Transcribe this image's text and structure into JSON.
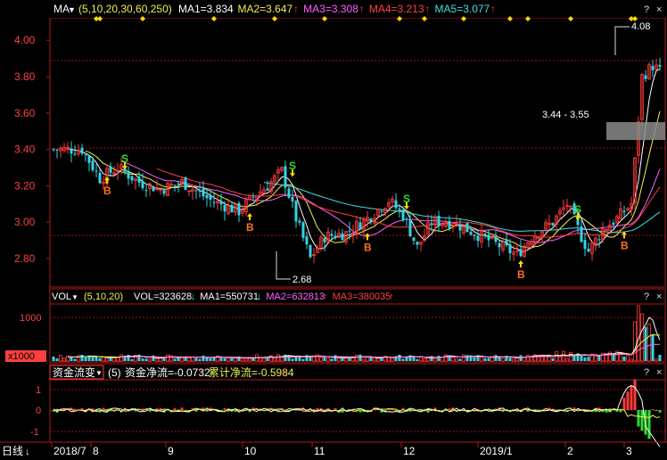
{
  "colors": {
    "bg": "#000000",
    "grid": "#8a1010",
    "frame": "#b01818",
    "up": "#ff3a3a",
    "down": "#32d6e6",
    "ma1": "#ffffff",
    "ma2": "#f0f050",
    "ma3": "#ff60ff",
    "ma4": "#ff4040",
    "ma5": "#40e0e0",
    "axis_text": "#ff4040",
    "header_text": "#ffffff",
    "signal_s": "#30e030",
    "signal_b": "#ff7020",
    "arrow": "#ffd800",
    "diamond": "#ffd800"
  },
  "main_panel": {
    "indicator": "MA",
    "params": "(5,10,20,30,60,250)",
    "legend": [
      {
        "text": "MA1=3.834",
        "color": "#ffffff"
      },
      {
        "text": "MA2=3.647",
        "color": "#f0f050",
        "arrow": "↑"
      },
      {
        "text": "MA3=3.308",
        "color": "#ff60ff",
        "arrow": "↑"
      },
      {
        "text": "MA4=3.213",
        "color": "#ff4040",
        "arrow": "↑"
      },
      {
        "text": "MA5=3.077",
        "color": "#40e0e0",
        "arrow": "↑"
      }
    ],
    "y_ticks": [
      "4.00",
      "3.80",
      "3.60",
      "3.40",
      "3.20",
      "3.00",
      "2.80"
    ],
    "annotations": {
      "high": "4.08",
      "low": "2.68",
      "range": "3.44 - 3.55"
    }
  },
  "vol_panel": {
    "indicator": "VOL",
    "params": "(5,10,20)",
    "legend": [
      {
        "text": "VOL=323628",
        "color": "#ffffff",
        "arrow": "↓",
        "arrow_color": "#40e0e0"
      },
      {
        "text": "MA1=550731",
        "color": "#ffffff",
        "arrow": "↓",
        "arrow_color": "#40e0e0"
      },
      {
        "text": "MA2=632813",
        "color": "#ff60ff",
        "arrow": "↑",
        "arrow_color": "#ff4040"
      },
      {
        "text": "MA3=380035",
        "color": "#ff4040",
        "arrow": "↑",
        "arrow_color": "#ff4040"
      }
    ],
    "y_ticks": [
      "1000"
    ],
    "unit": "x1000"
  },
  "flow_panel": {
    "indicator": "资金流变",
    "params": "(5)",
    "legend": [
      {
        "text": "资金净流=-0.0732",
        "color": "#ffffff",
        "arrow": "↑",
        "arrow_color": "#ff4040"
      },
      {
        "text": "累计净流=-0.5984",
        "color": "#f0f050",
        "arrow": "↑",
        "arrow_color": "#ff4040"
      }
    ],
    "y_ticks": [
      "1",
      "0",
      "-1"
    ]
  },
  "period_button": "日线",
  "question_mark": "?",
  "close_mark": "×",
  "x_labels": [
    "2018/7",
    "8",
    "9",
    "10",
    "11",
    "12",
    "2019/1",
    "2",
    "3"
  ],
  "chart_data": {
    "type": "candlestick",
    "ylim": [
      2.6,
      4.1
    ],
    "vol_ylim": [
      0,
      1400
    ],
    "flow_ylim": [
      -1.6,
      1.6
    ],
    "n_bars": 160,
    "anchors": [
      {
        "i": 0,
        "p": 3.4
      },
      {
        "i": 8,
        "p": 3.4
      },
      {
        "i": 13,
        "p": 3.24
      },
      {
        "i": 18,
        "p": 3.3
      },
      {
        "i": 24,
        "p": 3.22
      },
      {
        "i": 30,
        "p": 3.18
      },
      {
        "i": 36,
        "p": 3.22
      },
      {
        "i": 44,
        "p": 3.12
      },
      {
        "i": 52,
        "p": 3.06
      },
      {
        "i": 56,
        "p": 3.14
      },
      {
        "i": 60,
        "p": 3.2
      },
      {
        "i": 64,
        "p": 3.28
      },
      {
        "i": 68,
        "p": 3.02
      },
      {
        "i": 72,
        "p": 2.8
      },
      {
        "i": 76,
        "p": 2.92
      },
      {
        "i": 82,
        "p": 2.94
      },
      {
        "i": 88,
        "p": 3.02
      },
      {
        "i": 94,
        "p": 3.12
      },
      {
        "i": 98,
        "p": 3.04
      },
      {
        "i": 102,
        "p": 2.86
      },
      {
        "i": 106,
        "p": 3.0
      },
      {
        "i": 112,
        "p": 3.0
      },
      {
        "i": 118,
        "p": 2.94
      },
      {
        "i": 124,
        "p": 2.88
      },
      {
        "i": 130,
        "p": 2.82
      },
      {
        "i": 134,
        "p": 2.92
      },
      {
        "i": 140,
        "p": 3.0
      },
      {
        "i": 144,
        "p": 3.1
      },
      {
        "i": 148,
        "p": 2.92
      },
      {
        "i": 150,
        "p": 2.84
      },
      {
        "i": 154,
        "p": 2.96
      },
      {
        "i": 158,
        "p": 3.02
      },
      {
        "i": 162,
        "p": 3.1
      },
      {
        "i": 165,
        "p": 3.8
      },
      {
        "i": 168,
        "p": 3.86
      },
      {
        "i": 170,
        "p": 3.83
      }
    ],
    "signals": [
      {
        "type": "B",
        "i": 15,
        "p": 3.26
      },
      {
        "type": "S",
        "i": 20,
        "p": 3.28
      },
      {
        "type": "B",
        "i": 55,
        "p": 3.06
      },
      {
        "type": "S",
        "i": 67,
        "p": 3.24
      },
      {
        "type": "B",
        "i": 88,
        "p": 2.95
      },
      {
        "type": "S",
        "i": 99,
        "p": 3.06
      },
      {
        "type": "B",
        "i": 131,
        "p": 2.8
      },
      {
        "type": "S",
        "i": 147,
        "p": 3.0
      },
      {
        "type": "B",
        "i": 160,
        "p": 2.96
      }
    ],
    "diamonds": [
      12,
      13,
      25,
      45,
      62,
      76,
      97,
      104,
      115,
      128,
      133,
      145,
      162,
      163
    ],
    "volume_spikes": [
      {
        "i": 163,
        "v": 900
      },
      {
        "i": 164,
        "v": 1380
      },
      {
        "i": 165,
        "v": 1080
      },
      {
        "i": 166,
        "v": 780
      },
      {
        "i": 167,
        "v": 850
      },
      {
        "i": 168,
        "v": 600
      }
    ]
  }
}
